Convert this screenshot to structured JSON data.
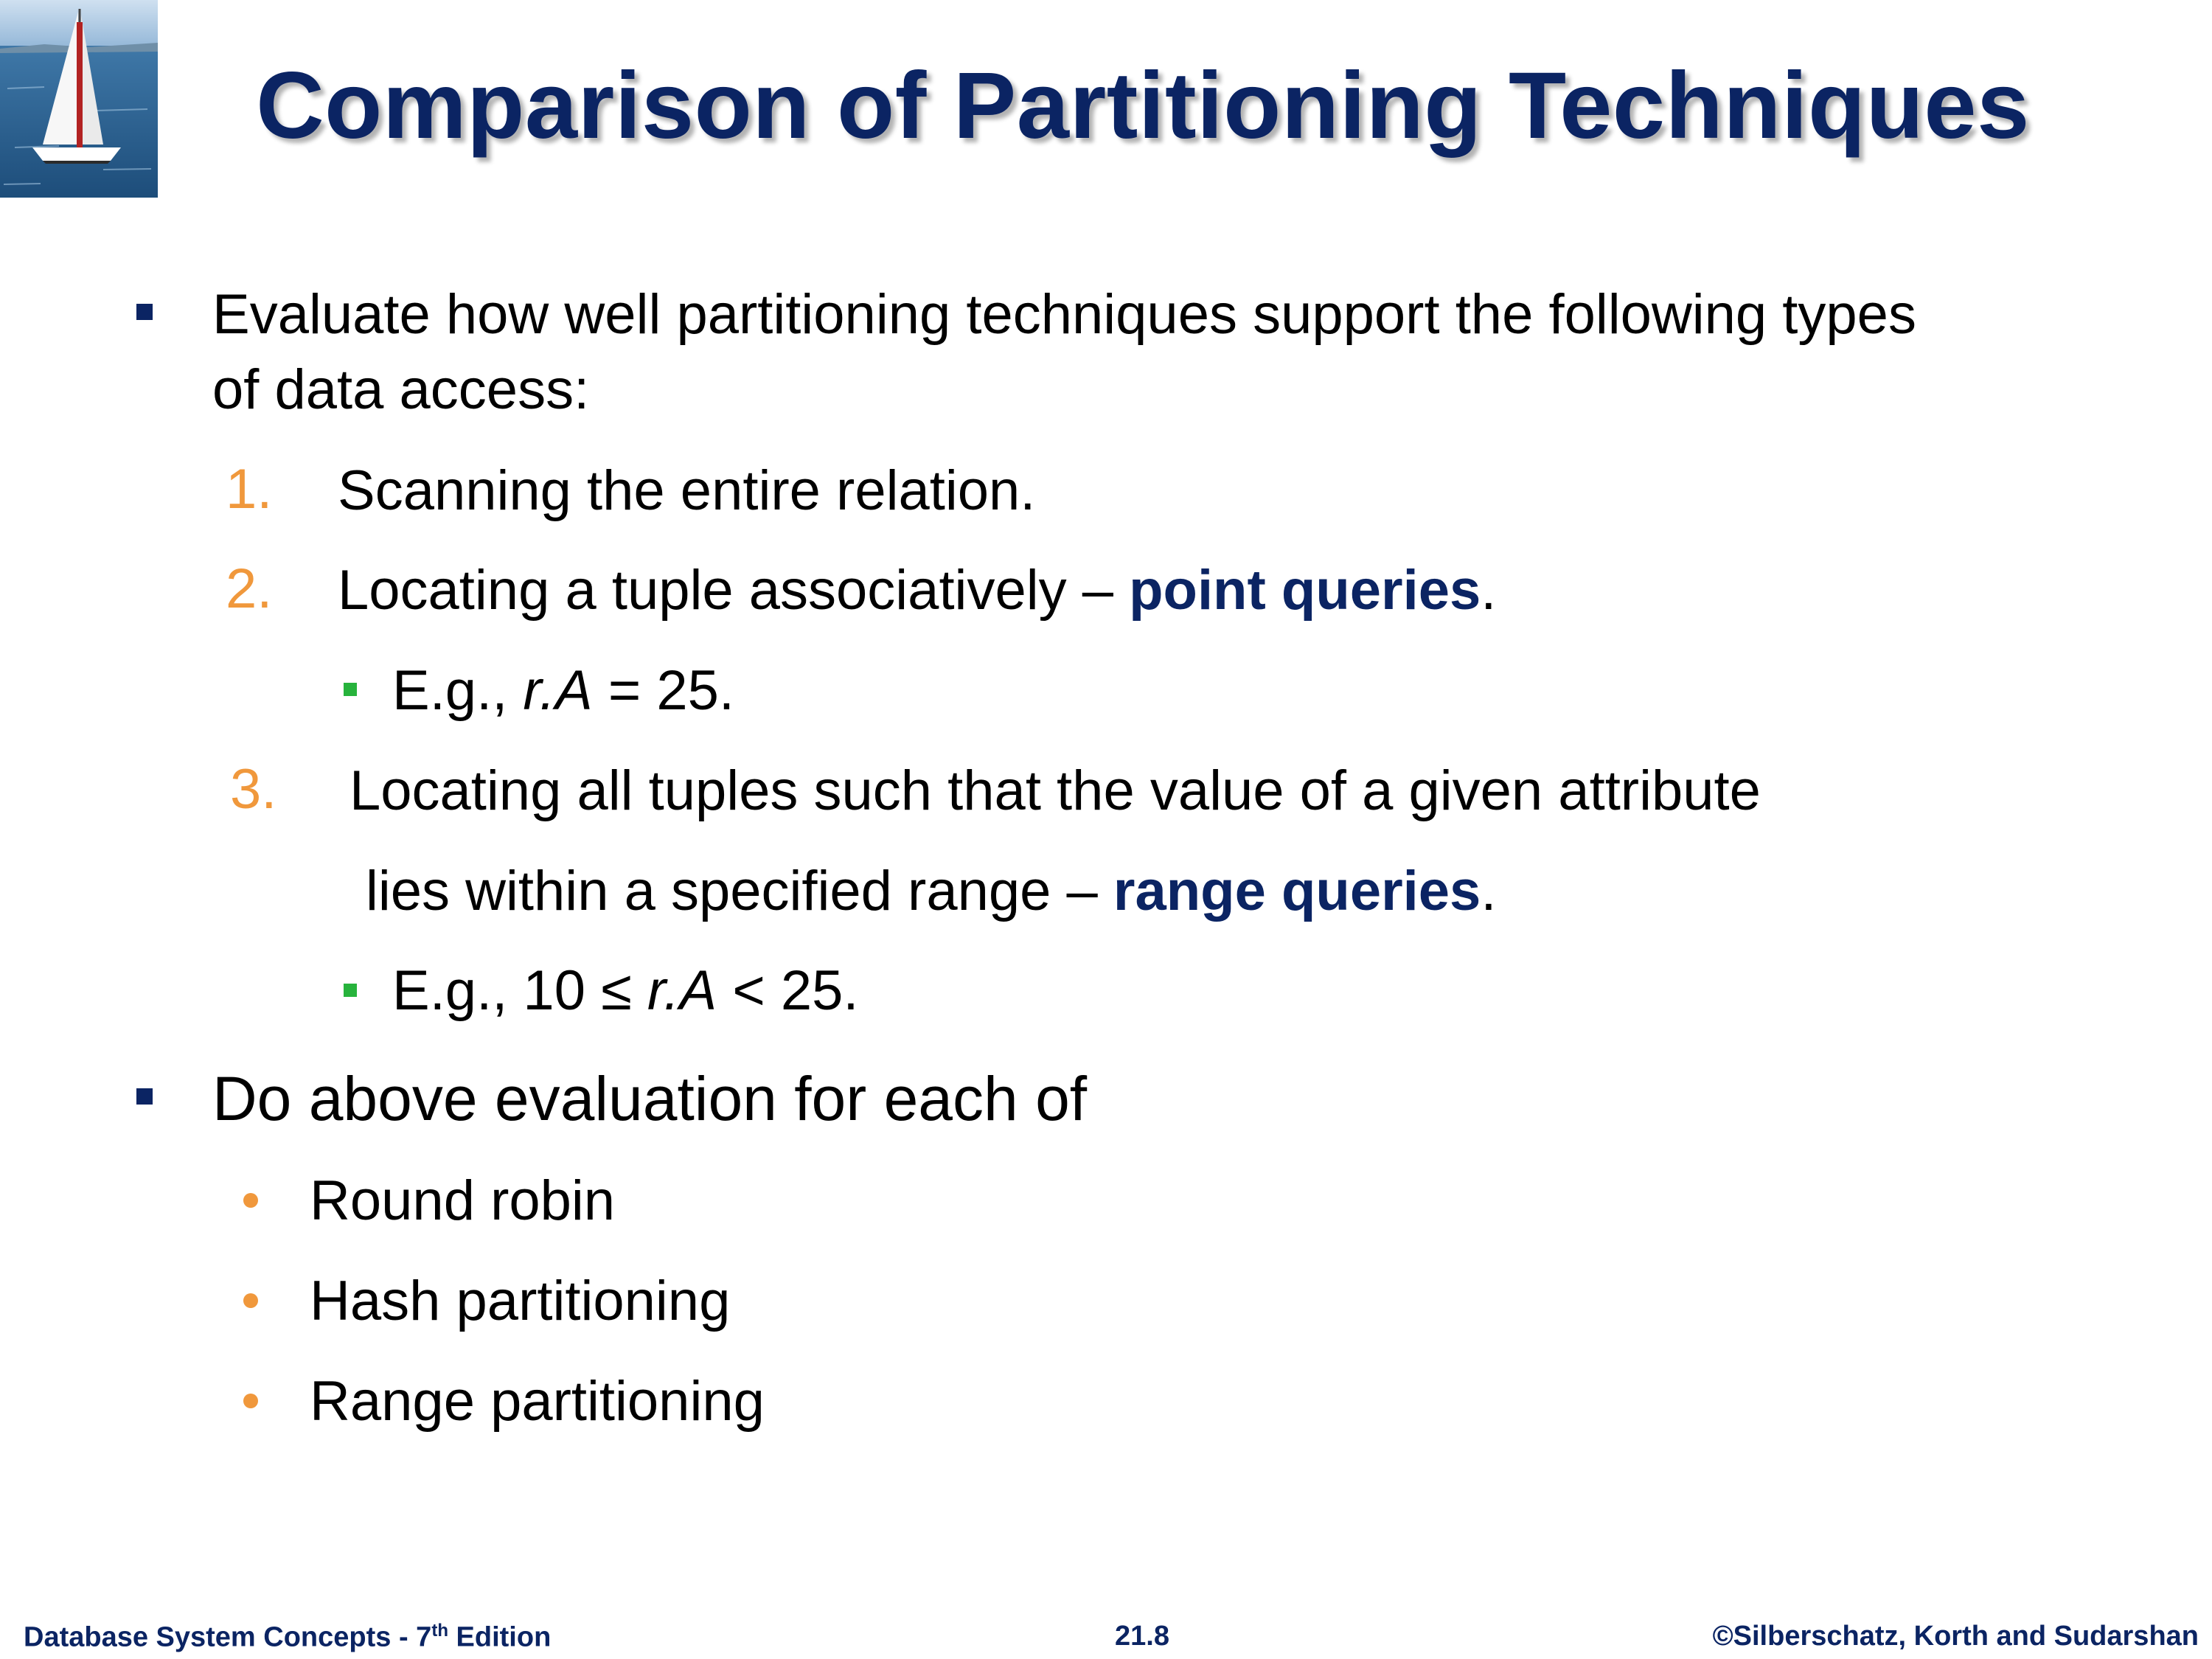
{
  "title": "Comparison of Partitioning Techniques",
  "bullet1": {
    "line1": "Evaluate how well partitioning techniques support the following types",
    "line2": "of data access:"
  },
  "items": [
    {
      "num": "1.",
      "text": "Scanning the entire relation."
    },
    {
      "num": "2.",
      "text_before": "Locating a tuple associatively – ",
      "keyword": "point queries",
      "text_after": "."
    },
    {
      "num": "3.",
      "line1": "Locating all tuples such that the value of a given attribute",
      "line2_before": "lies  within a specified range – ",
      "keyword": "range queries",
      "line2_after": "."
    }
  ],
  "example1": {
    "prefix": "E.g., ",
    "var": "r.A",
    "suffix": " = 25."
  },
  "example2": {
    "prefix": "E.g.,  10 ≤ ",
    "var": "r.A",
    "suffix": " < 25."
  },
  "bullet2": "Do above evaluation for each of",
  "techniques": [
    "Round robin",
    "Hash partitioning",
    "Range partitioning"
  ],
  "footer": {
    "left_prefix": "Database System Concepts - 7",
    "left_sup": "th",
    "left_suffix": " Edition",
    "center": "21.8",
    "right": "©Silberschatz, Korth and Sudarshan"
  },
  "colors": {
    "title": "#0b2463",
    "keyword": "#0b2463",
    "number": "#f0983c",
    "subbullet": "#27b33c"
  }
}
